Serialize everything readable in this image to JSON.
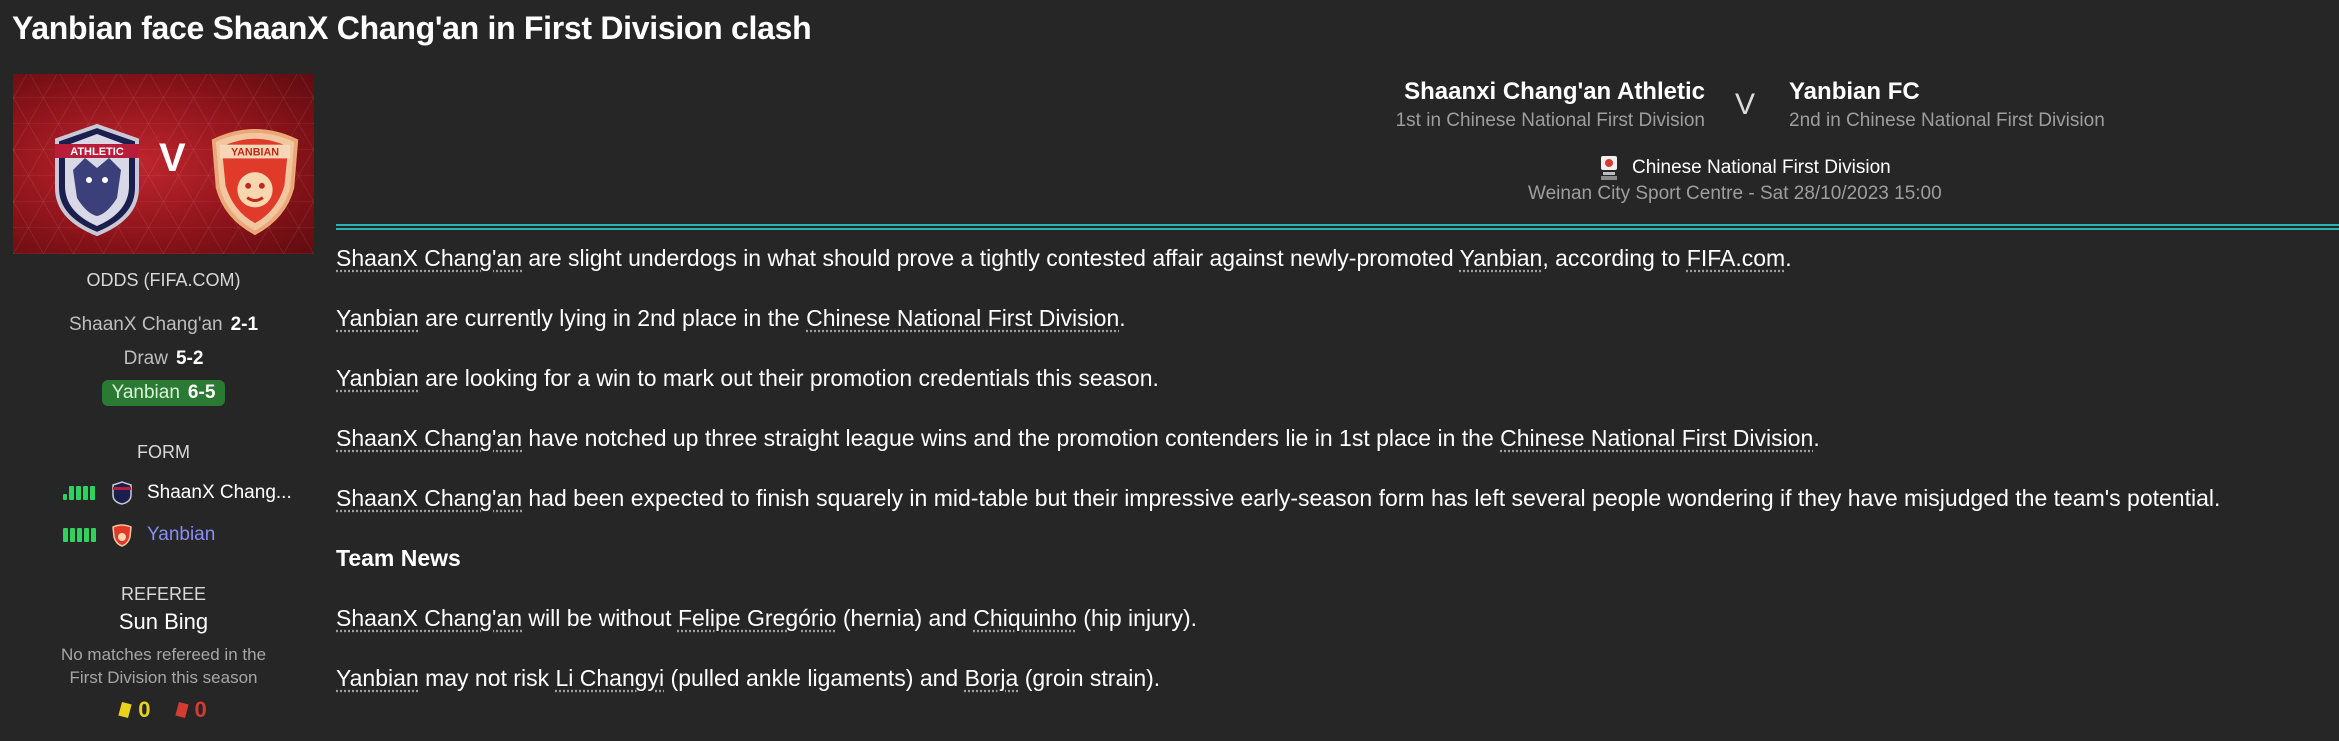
{
  "title": "Yanbian face ShaanX Chang'an in First Division clash",
  "banner": {
    "vs": "V",
    "home_crest_text": "ATHLETIC",
    "away_crest_text": "YANBIAN"
  },
  "odds": {
    "title": "ODDS (FIFA.COM)",
    "rows": [
      {
        "label": "ShaanX Chang'an",
        "value": "2-1"
      },
      {
        "label": "Draw",
        "value": "5-2"
      },
      {
        "label": "Yanbian",
        "value": "6-5"
      }
    ]
  },
  "form": {
    "title": "FORM",
    "rows": [
      {
        "team": "ShaanX Chang...",
        "color": "#ffffff"
      },
      {
        "team": "Yanbian",
        "color": "#8a8ef0"
      }
    ]
  },
  "referee": {
    "title": "REFEREE",
    "name": "Sun Bing",
    "note1": "No matches refereed in the",
    "note2": "First Division this season",
    "yellow": "0",
    "red": "0"
  },
  "match": {
    "home": {
      "name": "Shaanxi Chang'an Athletic",
      "position": "1st in Chinese National First Division"
    },
    "vs": "V",
    "away": {
      "name": "Yanbian FC",
      "position": "2nd in Chinese National First Division"
    },
    "competition": "Chinese National First Division",
    "venue": "Weinan City Sport Centre - Sat 28/10/2023 15:00"
  },
  "article": {
    "p1": {
      "a": "ShaanX Chang'an",
      "b": " are slight underdogs in what should prove a tightly contested affair against newly-promoted ",
      "c": "Yanbian",
      "d": ", according to ",
      "e": "FIFA.com",
      "f": "."
    },
    "p2": {
      "a": "Yanbian",
      "b": " are currently lying in 2nd place in the ",
      "c": "Chinese National First Division",
      "d": "."
    },
    "p3": {
      "a": "Yanbian",
      "b": " are looking for a win to mark out their promotion credentials this season."
    },
    "p4": {
      "a": "ShaanX Chang'an",
      "b": " have notched up three straight league wins and the promotion contenders lie in 1st place in the ",
      "c": "Chinese National First Division",
      "d": "."
    },
    "p5": {
      "a": "ShaanX Chang'an",
      "b": " had been expected to finish squarely in mid-table but their impressive early-season form has left several people wondering if they have misjudged the team's potential."
    },
    "team_news": "Team News",
    "p6": {
      "a": "ShaanX Chang'an",
      "b": " will be without ",
      "c": "Felipe Gregório",
      "d": " (hernia) and ",
      "e": "Chiquinho",
      "f": " (hip injury)."
    },
    "p7": {
      "a": "Yanbian",
      "b": " may not risk ",
      "c": "Li Changyi",
      "d": " (pulled ankle ligaments) and ",
      "e": "Borja",
      "f": " (groin strain)."
    }
  }
}
